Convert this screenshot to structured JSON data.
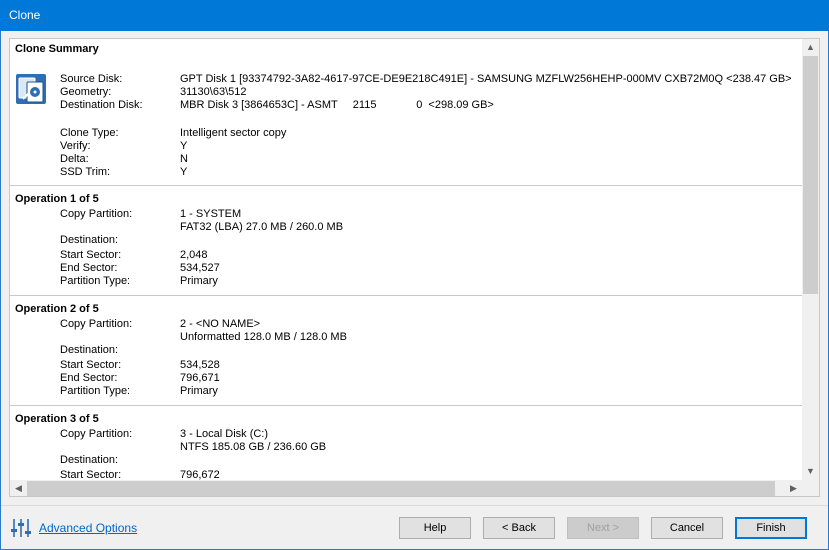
{
  "window": {
    "title": "Clone"
  },
  "summary": {
    "title": "Clone Summary",
    "rows": [
      {
        "label": "Source Disk:",
        "value": "GPT Disk 1 [93374792-3A82-4617-97CE-DE9E218C491E] - SAMSUNG MZFLW256HEHP-000MV CXB72M0Q  <238.47 GB>"
      },
      {
        "label": "Geometry:",
        "value": "31130\\63\\512"
      },
      {
        "label": "Destination Disk:",
        "value": "MBR Disk 3 [3864653C] - ASMT     2115             0  <298.09 GB>"
      },
      {
        "label": "Clone Type:",
        "value": "Intelligent sector copy"
      },
      {
        "label": "Verify:",
        "value": "Y"
      },
      {
        "label": "Delta:",
        "value": "N"
      },
      {
        "label": "SSD Trim:",
        "value": "Y"
      }
    ]
  },
  "operations": [
    {
      "title": "Operation 1 of 5",
      "copy_label": "Copy Partition:",
      "copy_value": "1 - SYSTEM",
      "copy_detail": "FAT32 (LBA) 27.0 MB / 260.0 MB",
      "dest_label": "Destination:",
      "start_label": "Start Sector:",
      "start_value": "2,048",
      "end_label": "End Sector:",
      "end_value": "534,527",
      "type_label": "Partition Type:",
      "type_value": "Primary"
    },
    {
      "title": "Operation 2 of 5",
      "copy_label": "Copy Partition:",
      "copy_value": "2 - <NO NAME>",
      "copy_detail": "Unformatted 128.0 MB / 128.0 MB",
      "dest_label": "Destination:",
      "start_label": "Start Sector:",
      "start_value": "534,528",
      "end_label": "End Sector:",
      "end_value": "796,671",
      "type_label": "Partition Type:",
      "type_value": "Primary"
    },
    {
      "title": "Operation 3 of 5",
      "copy_label": "Copy Partition:",
      "copy_value": "3 - Local Disk (C:)",
      "copy_detail": "NTFS 185.08 GB / 236.60 GB",
      "dest_label": "Destination:",
      "start_label": "Start Sector:",
      "start_value": "796,672"
    }
  ],
  "footer": {
    "advanced_options": "Advanced Options",
    "help": "Help",
    "back": "< Back",
    "next": "Next >",
    "cancel": "Cancel",
    "finish": "Finish"
  },
  "colors": {
    "titlebar": "#0078d7",
    "link": "#0066cc"
  }
}
